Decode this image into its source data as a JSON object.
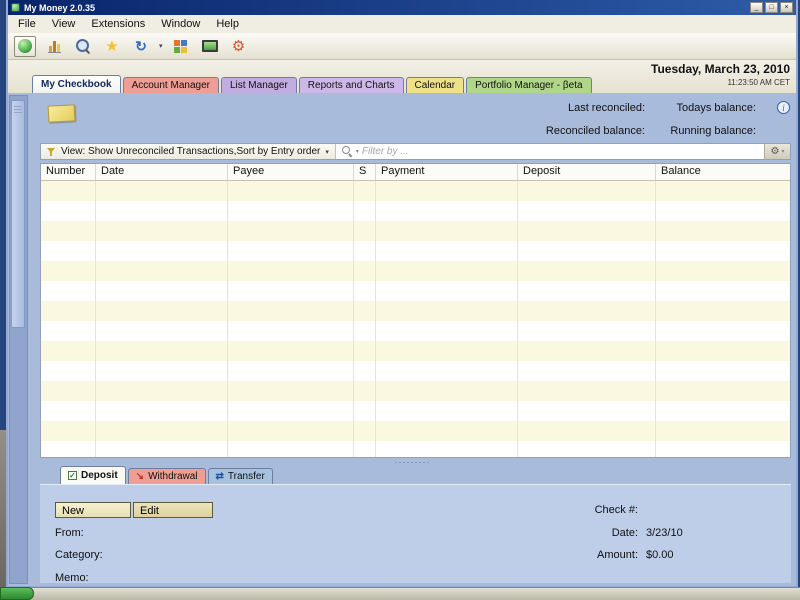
{
  "window": {
    "title": "My Money 2.0.35"
  },
  "window_controls": {
    "minimize": "_",
    "maximize": "□",
    "close": "×"
  },
  "menu": {
    "items": [
      "File",
      "View",
      "Extensions",
      "Window",
      "Help"
    ]
  },
  "toolbar": {
    "icons": [
      "home-icon",
      "chart-icon",
      "zoom-icon",
      "star-icon",
      "refresh-icon",
      "grid-icon",
      "screen-icon",
      "gear-icon"
    ]
  },
  "header": {
    "date": "Tuesday, March 23, 2010",
    "time": "11:23:50 AM CET"
  },
  "tabs": [
    {
      "label": "My Checkbook",
      "active": true,
      "color": "#FCFCF6"
    },
    {
      "label": "Account Manager",
      "active": false,
      "color": "#EF9E96"
    },
    {
      "label": "List Manager",
      "active": false,
      "color": "#C2ADE0"
    },
    {
      "label": "Reports and Charts",
      "active": false,
      "color": "#CDB9E8"
    },
    {
      "label": "Calendar",
      "active": false,
      "color": "#EFE187"
    },
    {
      "label": "Portfolio Manager - βeta",
      "active": false,
      "color": "#AFD689"
    }
  ],
  "summary": {
    "last_reconciled_label": "Last reconciled:",
    "todays_balance_label": "Todays balance:",
    "reconciled_balance_label": "Reconciled balance:",
    "running_balance_label": "Running balance:"
  },
  "viewbar": {
    "view_label": "View: Show Unreconciled Transactions,Sort by Entry order",
    "filter_placeholder": "Filter by ..."
  },
  "table": {
    "columns": [
      {
        "label": "Number",
        "width": 55
      },
      {
        "label": "Date",
        "width": 132
      },
      {
        "label": "Payee",
        "width": 126
      },
      {
        "label": "S",
        "width": 22
      },
      {
        "label": "Payment",
        "width": 142
      },
      {
        "label": "Deposit",
        "width": 138
      },
      {
        "label": "Balance",
        "width": 135
      }
    ],
    "row_count": 14
  },
  "bottom_panel": {
    "tabs": [
      {
        "label": "Deposit",
        "active": true,
        "color": "#FAFAF5"
      },
      {
        "label": "Withdrawal",
        "active": false,
        "color": "#EF9E94"
      },
      {
        "label": "Transfer",
        "active": false,
        "color": "#A6C2DE"
      }
    ],
    "buttons": {
      "new": "New",
      "edit": "Edit"
    },
    "fields": {
      "from_label": "From:",
      "category_label": "Category:",
      "memo_label": "Memo:",
      "check_label": "Check #:",
      "date_label": "Date:",
      "date_value": "3/23/10",
      "amount_label": "Amount:",
      "amount_value": "$0.00"
    }
  },
  "icons": {
    "star": "★",
    "refresh": "↻",
    "gear": "⚙",
    "caret": "▾",
    "info": "i",
    "deposit_check": "✓",
    "withdrawal_arrow": "↘",
    "transfer_arrows": "⇄",
    "splitter_dots": "·········"
  },
  "theme": {
    "content_bg": "#A9BBDB",
    "panel_bg": "#BECDE8",
    "row_stripe": "#FAF8E1",
    "titlebar": "#0A246A"
  }
}
